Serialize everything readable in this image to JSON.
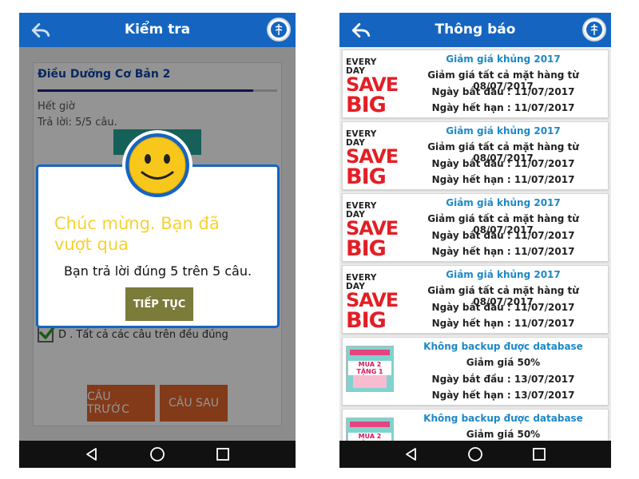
{
  "left": {
    "header": {
      "title": "Kiểm tra"
    },
    "quiz": {
      "course": "Điều Dưỡng Cơ Bản 2",
      "progress_fraction": 0.9,
      "status_time": "Hết giờ",
      "status_answered": "Trả lời: 5/5 câu.",
      "option_text": "D . Tất cả các câu trên đều đúng",
      "prev_label": "CÂU TRƯỚC",
      "next_label": "CÂU SAU"
    },
    "dialog": {
      "congrats": "Chúc mừng. Bạn đã vượt qua",
      "result": "Bạn trả lời đúng 5 trên 5 câu.",
      "continue_label": "TIẾP TỤC"
    }
  },
  "right": {
    "header": {
      "title": "Thông báo"
    },
    "promo_image": {
      "line1": "EVERY DAY",
      "line2": "SAVE",
      "line3": "BIG"
    },
    "promo_image_2": {
      "line1": "MUA 2 TẶNG 1"
    },
    "notifications": [
      {
        "title": "Giảm giá khủng 2017",
        "desc": "Giảm giá tất cả mặt hàng từ 08/07/2017",
        "start": "Ngày bắt đầu : 11/07/2017",
        "end": "Ngày hết hạn : 11/07/2017"
      },
      {
        "title": "Giảm giá khủng 2017",
        "desc": "Giảm giá tất cả mặt hàng từ 08/07/2017",
        "start": "Ngày bắt đầu : 11/07/2017",
        "end": "Ngày hết hạn : 11/07/2017"
      },
      {
        "title": "Giảm giá khủng 2017",
        "desc": "Giảm giá tất cả mặt hàng từ 08/07/2017",
        "start": "Ngày bắt đầu : 11/07/2017",
        "end": "Ngày hết hạn : 11/07/2017"
      },
      {
        "title": "Giảm giá khủng 2017",
        "desc": "Giảm giá tất cả mặt hàng từ 08/07/2017",
        "start": "Ngày bắt đầu : 11/07/2017",
        "end": "Ngày hết hạn : 11/07/2017"
      },
      {
        "title": "Không backup được database",
        "desc": "Giảm giá 50%",
        "start": "Ngày bắt đầu : 13/07/2017",
        "end": "Ngày hết hạn : 13/07/2017"
      },
      {
        "title": "Không backup được database",
        "desc": "Giảm giá 50%",
        "start": "",
        "end": ""
      }
    ]
  },
  "icons": {
    "back": "arrow-back-icon",
    "logo": "caduceus-logo-icon",
    "nav_back": "triangle-back-icon",
    "nav_home": "circle-home-icon",
    "nav_recent": "square-recent-icon"
  },
  "colors": {
    "appbar": "#1565c0",
    "accent_orange": "#e0652a",
    "continue_olive": "#7b7b3a",
    "congrats_yellow": "#f6d136",
    "title_blue": "#1e88c7"
  }
}
